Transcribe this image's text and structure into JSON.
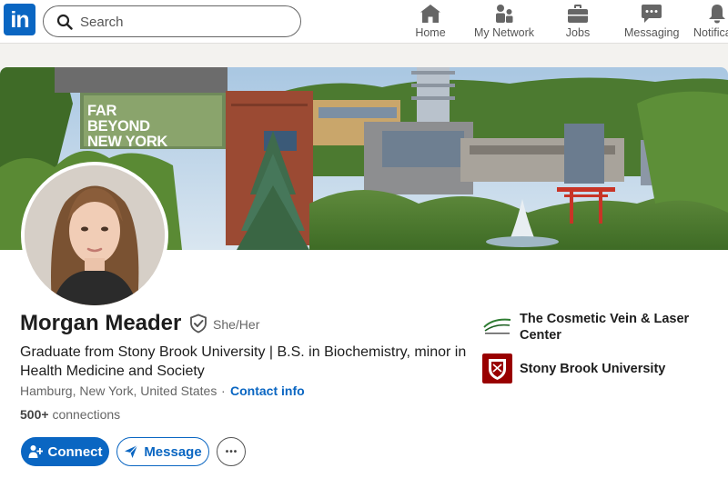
{
  "nav": {
    "logo": "in",
    "search_placeholder": "Search",
    "items": [
      {
        "label": "Home",
        "icon": "home-icon"
      },
      {
        "label": "My Network",
        "icon": "network-icon"
      },
      {
        "label": "Jobs",
        "icon": "briefcase-icon"
      },
      {
        "label": "Messaging",
        "icon": "chat-icon"
      },
      {
        "label": "Notifications",
        "icon": "bell-icon"
      }
    ]
  },
  "banner": {
    "sign_lines": [
      "FAR",
      "BEYOND",
      "NEW YORK"
    ]
  },
  "profile": {
    "name": "Morgan Meader",
    "pronouns": "She/Her",
    "headline": "Graduate from Stony Brook University | B.S. in Biochemistry, minor in Health Medicine and Society",
    "location": "Hamburg, New York, United States",
    "separator": "·",
    "contact_info": "Contact info",
    "connections_count": "500+",
    "connections_label": "connections"
  },
  "actions": {
    "connect": "Connect",
    "message": "Message",
    "more": "•••"
  },
  "experience": [
    {
      "name": "The Cosmetic Vein & Laser Center"
    },
    {
      "name": "Stony Brook University"
    }
  ],
  "colors": {
    "brand": "#0a66c2",
    "stony_brook_red": "#990000"
  }
}
